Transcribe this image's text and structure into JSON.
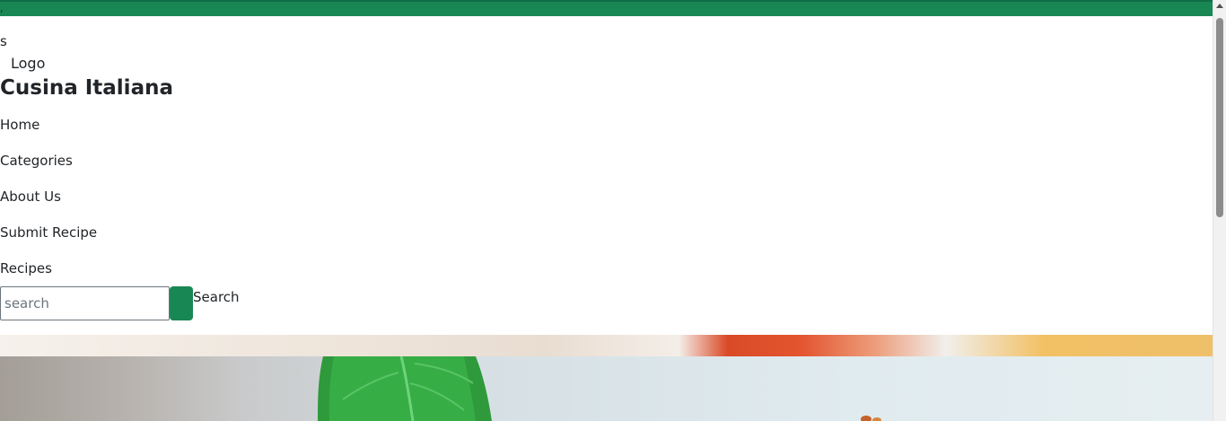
{
  "topbar": {
    "stray_char": ","
  },
  "header": {
    "stray_text": "s",
    "logo_alt": "Logo",
    "site_title": "Cusina Italiana"
  },
  "nav": {
    "items": [
      {
        "label": "Home"
      },
      {
        "label": "Categories"
      },
      {
        "label": "About Us"
      },
      {
        "label": "Submit Recipe"
      },
      {
        "label": "Recipes"
      }
    ]
  },
  "search": {
    "placeholder": "search",
    "button_label": "Search"
  },
  "colors": {
    "brand_green": "#198754",
    "text": "#212529"
  }
}
